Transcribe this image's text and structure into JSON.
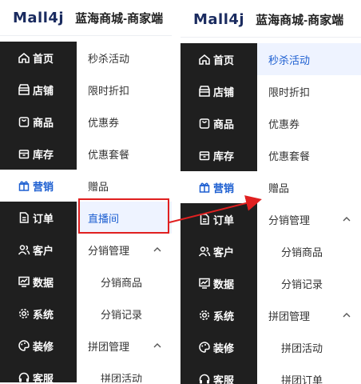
{
  "app": {
    "logo": "Mall4j",
    "shop_title": "蓝海商城-商家端"
  },
  "nav": [
    {
      "id": "home",
      "label": "首页",
      "icon": "home-icon"
    },
    {
      "id": "store",
      "label": "店铺",
      "icon": "store-icon"
    },
    {
      "id": "product",
      "label": "商品",
      "icon": "bag-icon"
    },
    {
      "id": "stock",
      "label": "库存",
      "icon": "box-icon"
    },
    {
      "id": "marketing",
      "label": "营销",
      "icon": "gift-icon",
      "active": true
    },
    {
      "id": "order",
      "label": "订单",
      "icon": "document-icon"
    },
    {
      "id": "customer",
      "label": "客户",
      "icon": "users-icon"
    },
    {
      "id": "data",
      "label": "数据",
      "icon": "chart-icon"
    },
    {
      "id": "system",
      "label": "系统",
      "icon": "gear-icon"
    },
    {
      "id": "decor",
      "label": "装修",
      "icon": "palette-icon"
    },
    {
      "id": "service",
      "label": "客服",
      "icon": "headset-icon"
    }
  ],
  "left_submenu": [
    {
      "label": "秒杀活动"
    },
    {
      "label": "限时折扣"
    },
    {
      "label": "优惠券"
    },
    {
      "label": "优惠套餐"
    },
    {
      "label": "赠品"
    },
    {
      "label": "直播间",
      "highlight": true
    },
    {
      "label": "分销管理",
      "expanded": true
    },
    {
      "label": "分销商品",
      "child": true
    },
    {
      "label": "分销记录",
      "child": true
    },
    {
      "label": "拼团管理",
      "expanded": true
    },
    {
      "label": "拼团活动",
      "child": true
    }
  ],
  "right_submenu": [
    {
      "label": "秒杀活动",
      "selected": true
    },
    {
      "label": "限时折扣"
    },
    {
      "label": "优惠券"
    },
    {
      "label": "优惠套餐"
    },
    {
      "label": "赠品"
    },
    {
      "label": "分销管理",
      "expanded": true
    },
    {
      "label": "分销商品",
      "child": true
    },
    {
      "label": "分销记录",
      "child": true
    },
    {
      "label": "拼团管理",
      "expanded": true
    },
    {
      "label": "拼团活动",
      "child": true
    },
    {
      "label": "拼团订单",
      "child": true
    }
  ],
  "colors": {
    "accent": "#1d5fd1",
    "sidebar": "#1f1f1f",
    "annotation": "#e02020"
  }
}
